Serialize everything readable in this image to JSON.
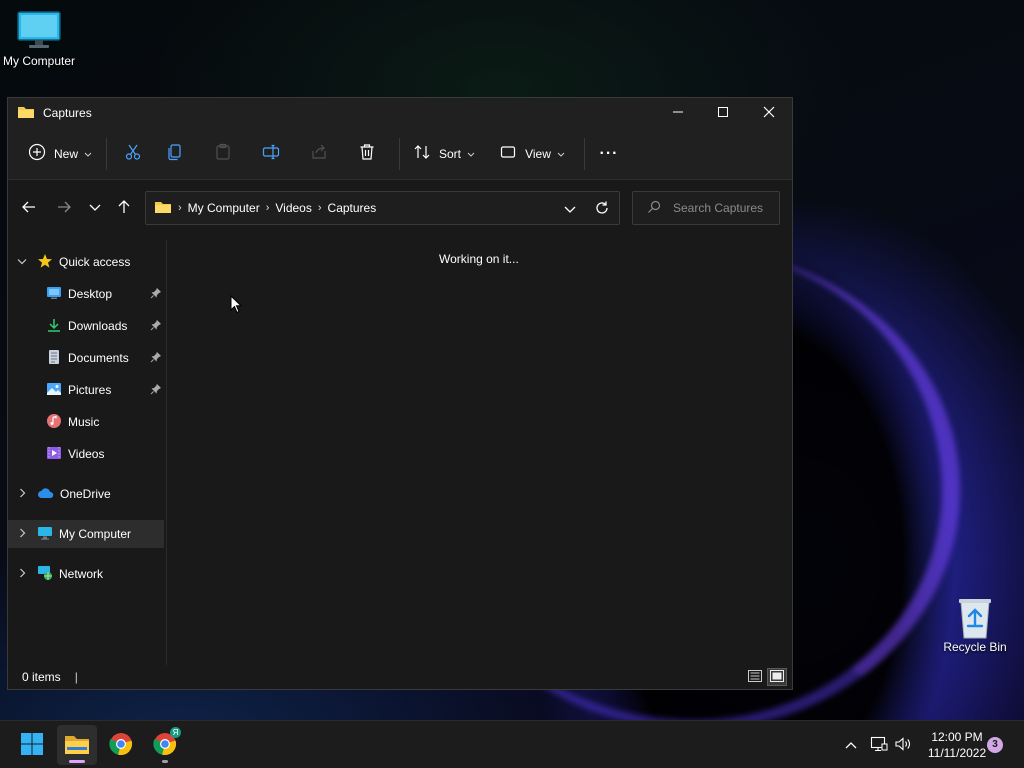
{
  "desktop": {
    "icons": [
      {
        "label": "My Computer"
      },
      {
        "label": "Recycle Bin"
      }
    ]
  },
  "window": {
    "title": "Captures",
    "controls": {
      "minimize": "minimize",
      "maximize": "maximize",
      "close": "close"
    }
  },
  "toolbar": {
    "new_label": "New",
    "sort_label": "Sort",
    "view_label": "View",
    "more_label": "···"
  },
  "address": {
    "crumbs": [
      "My Computer",
      "Videos",
      "Captures"
    ],
    "separator": "›"
  },
  "search": {
    "placeholder": "Search Captures"
  },
  "sidebar": {
    "quick_access": "Quick access",
    "items": [
      {
        "label": "Desktop",
        "icon": "desktop-icon",
        "pinned": true
      },
      {
        "label": "Downloads",
        "icon": "downloads-icon",
        "pinned": true
      },
      {
        "label": "Documents",
        "icon": "documents-icon",
        "pinned": true
      },
      {
        "label": "Pictures",
        "icon": "pictures-icon",
        "pinned": true
      },
      {
        "label": "Music",
        "icon": "music-icon",
        "pinned": false
      },
      {
        "label": "Videos",
        "icon": "videos-icon",
        "pinned": false
      }
    ],
    "onedrive": "OneDrive",
    "my_computer": "My Computer",
    "network": "Network"
  },
  "content": {
    "status_message": "Working on it..."
  },
  "statusbar": {
    "items_count": "0 items",
    "divider": "|"
  },
  "taskbar": {
    "apps": [
      "start",
      "file-explorer",
      "chrome",
      "chrome-profile"
    ],
    "profile_badge": "Я",
    "time": "12:00 PM",
    "date": "11/11/2022",
    "notification_count": "3"
  },
  "colors": {
    "accent": "#0078d4",
    "window_bg": "#191919",
    "titlebar_bg": "#202020",
    "folder_yellow": "#f2c94c",
    "running_indicator": "#e0a3ff"
  }
}
